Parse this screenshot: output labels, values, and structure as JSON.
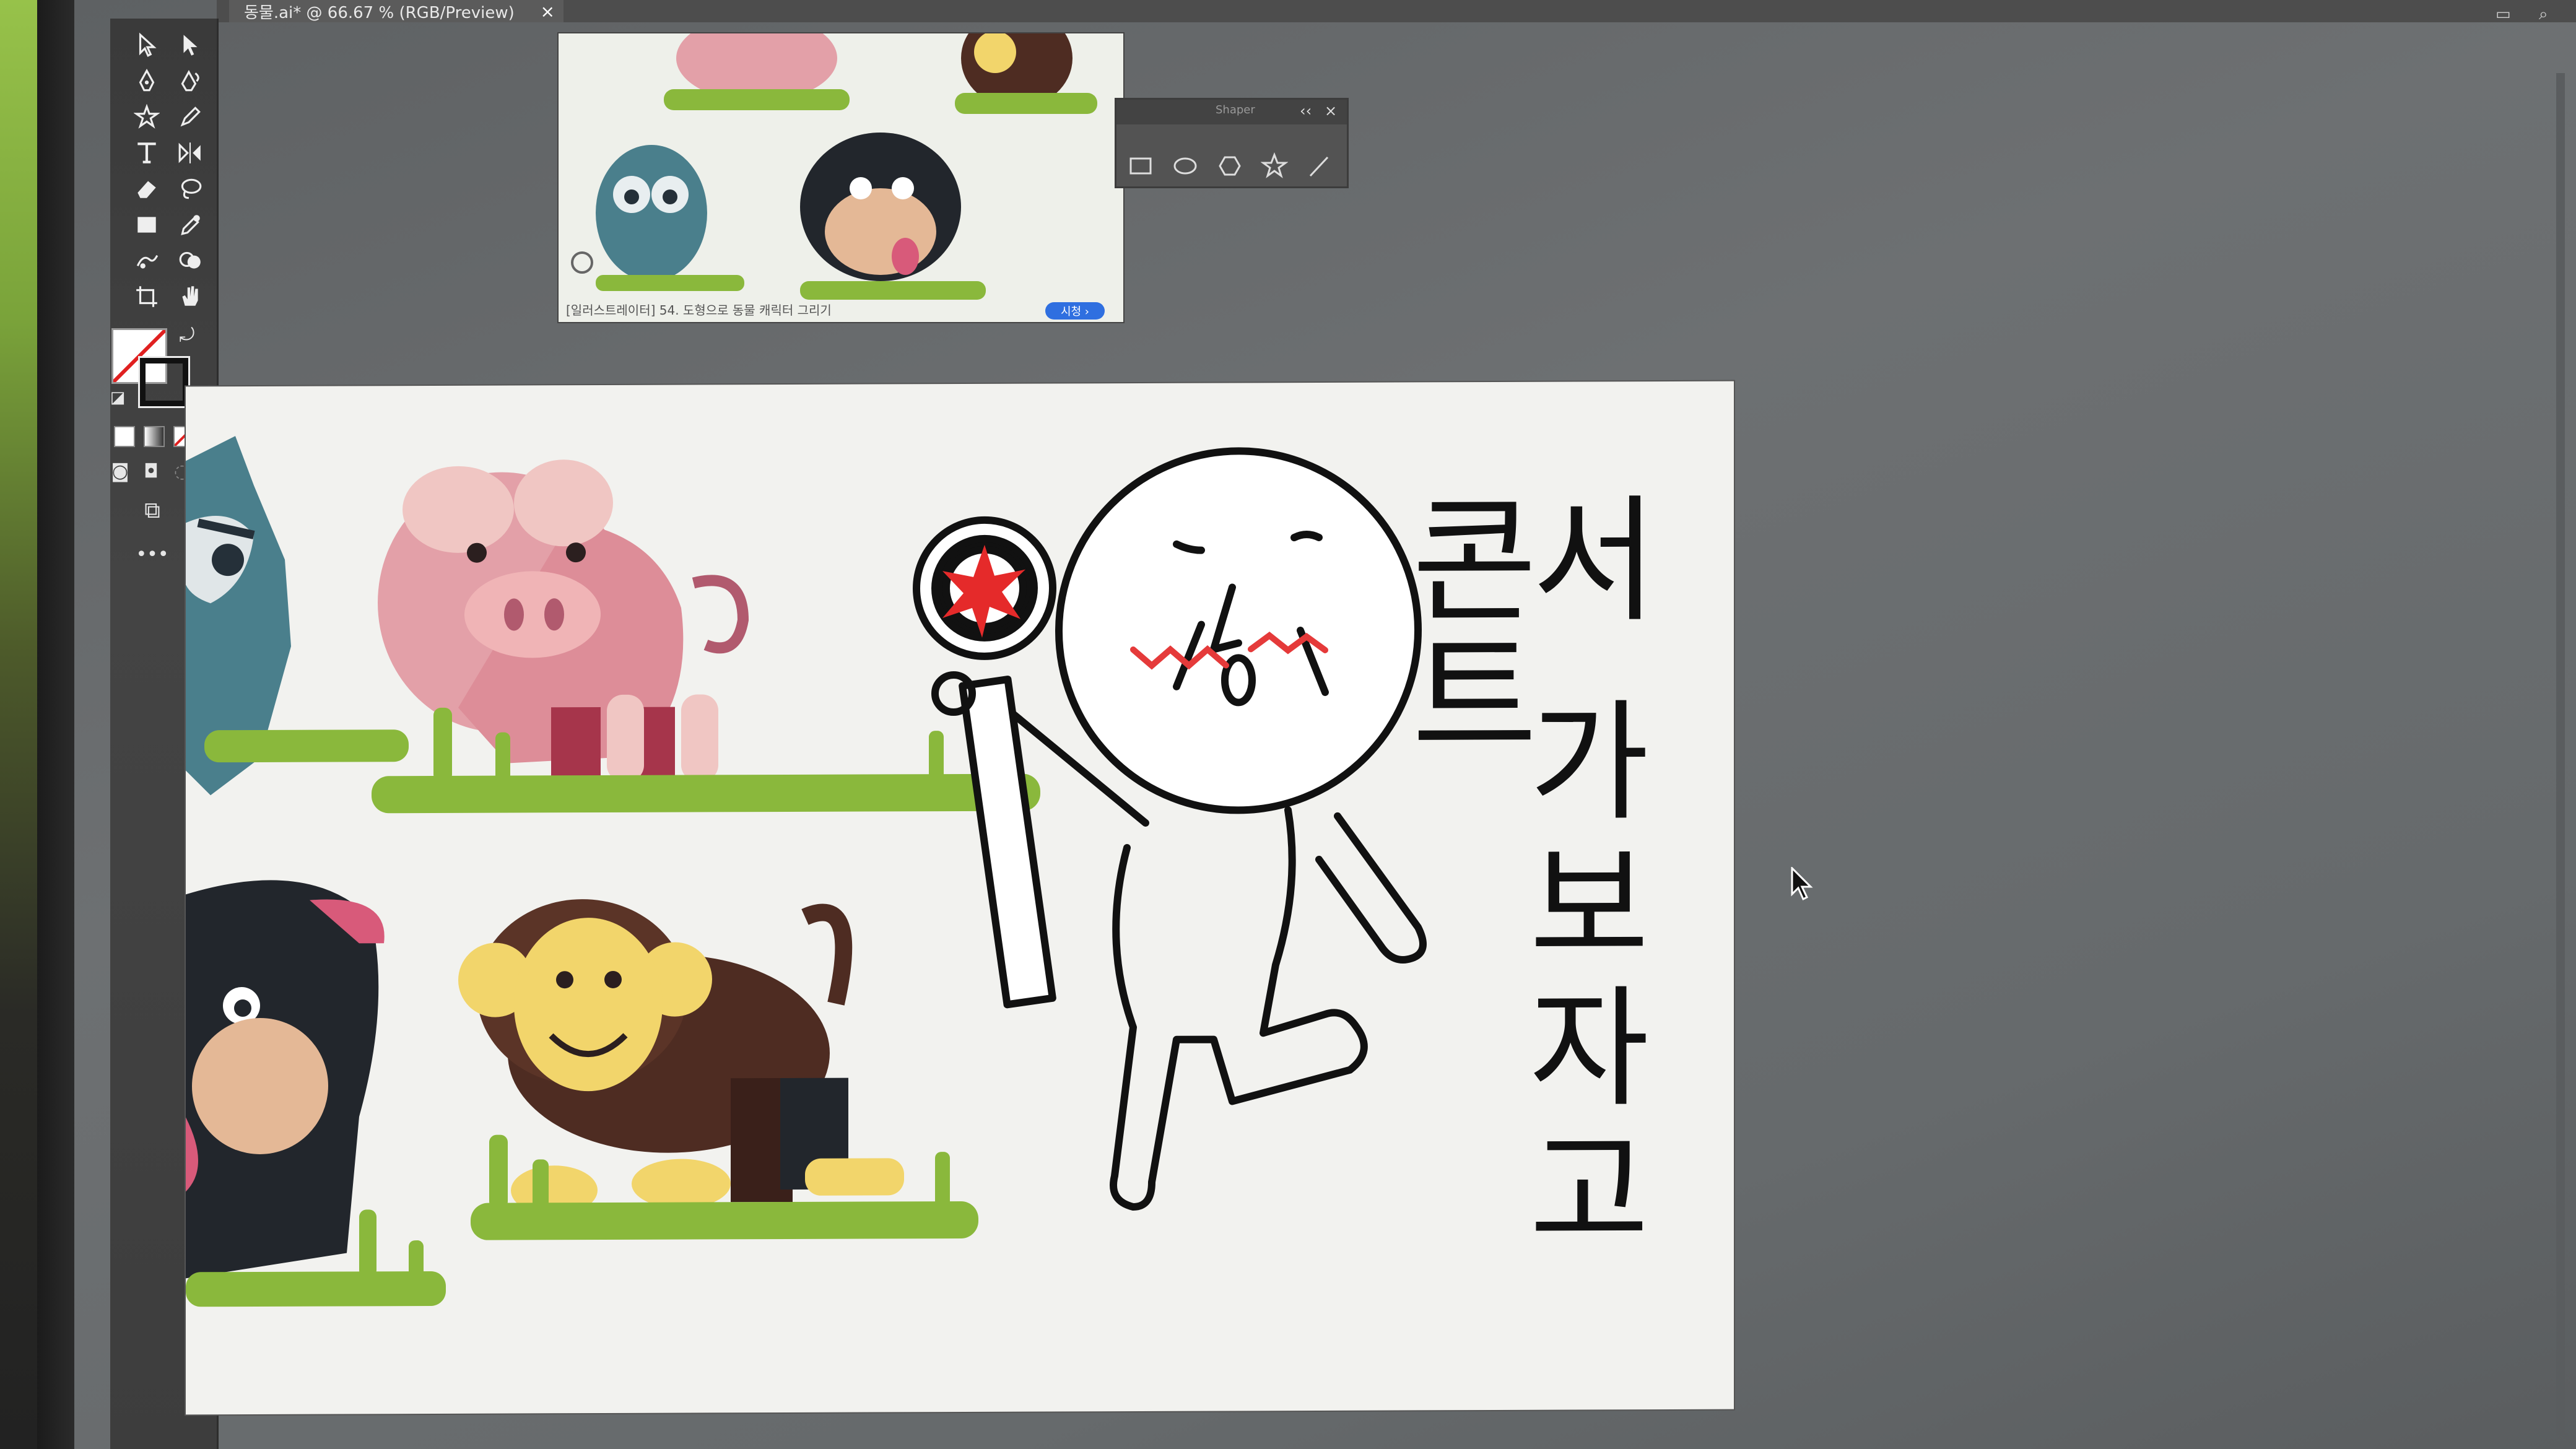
{
  "document": {
    "tab_title": "동물.ai* @ 66.67 % (RGB/Preview)",
    "close_glyph": "×"
  },
  "toolbar": {
    "tools": [
      {
        "name": "selection-tool-icon"
      },
      {
        "name": "direct-selection-tool-icon"
      },
      {
        "name": "pen-tool-icon"
      },
      {
        "name": "curvature-tool-icon"
      },
      {
        "name": "star-tool-icon"
      },
      {
        "name": "pencil-tool-icon"
      },
      {
        "name": "type-tool-icon"
      },
      {
        "name": "reflect-tool-icon"
      },
      {
        "name": "eraser-tool-icon"
      },
      {
        "name": "lasso-tool-icon"
      },
      {
        "name": "rectangle-tool-icon"
      },
      {
        "name": "eyedropper-tool-icon"
      },
      {
        "name": "puppet-warp-tool-icon"
      },
      {
        "name": "shape-builder-tool-icon"
      },
      {
        "name": "artboard-tool-icon"
      },
      {
        "name": "hand-tool-icon"
      }
    ],
    "more_label": "•••"
  },
  "reference_image": {
    "caption": "[일러스트레이터] 54. 도형으로 동물 캐릭터 그리기",
    "button_label": "시청 ›"
  },
  "shapes_panel": {
    "title": "Shaper",
    "collapse_glyph": "‹‹",
    "close_glyph": "×",
    "shapes": [
      "rectangle-icon",
      "ellipse-icon",
      "polygon-icon",
      "star-icon",
      "line-icon"
    ]
  },
  "artwork": {
    "handwriting_line1": "콘서트",
    "handwriting_line2": "가보자고",
    "animals": [
      "owl",
      "pig",
      "monkey",
      "dog"
    ],
    "sign_star_color": "#e52a2a",
    "blush_color": "#e53a3a"
  },
  "colors": {
    "canvas_bg": "#6c6f70",
    "toolbar_bg": "#3a3a3a",
    "grass": "#8ab83c",
    "pig": "#e3a0a8",
    "monkey_face": "#f2d56b",
    "monkey_body": "#4e2c22"
  }
}
